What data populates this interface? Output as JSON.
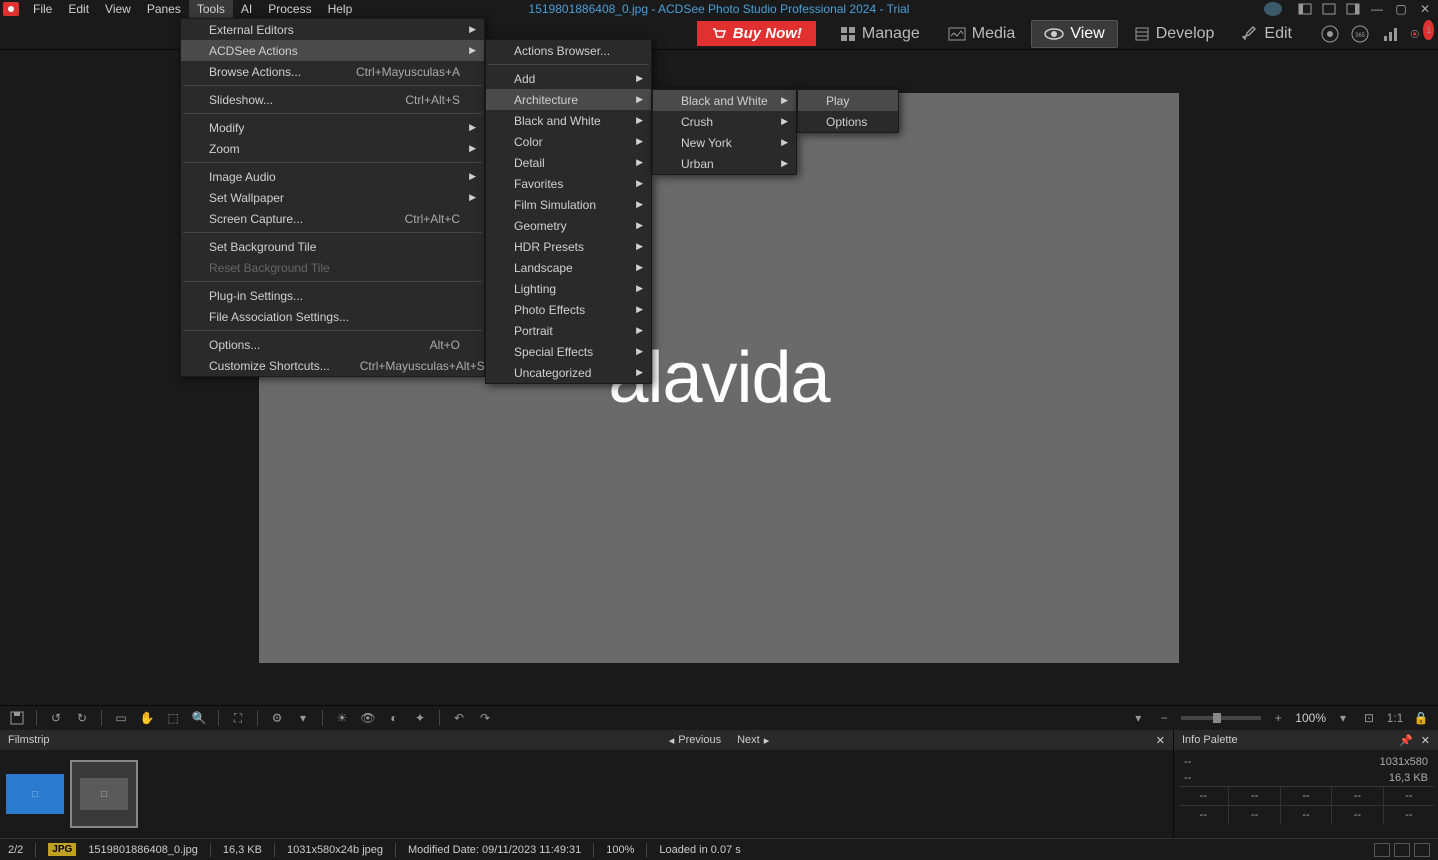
{
  "app": {
    "title": "1519801886408_0.jpg - ACDSee Photo Studio Professional 2024 - Trial"
  },
  "menubar": {
    "items": [
      "File",
      "Edit",
      "View",
      "Panes",
      "Tools",
      "AI",
      "Process",
      "Help"
    ],
    "active_index": 4
  },
  "modebar": {
    "buy": "Buy Now!",
    "modes": [
      "Manage",
      "Media",
      "View",
      "Develop",
      "Edit"
    ],
    "active_index": 2,
    "notification_count": "1"
  },
  "tools_menu": {
    "items": [
      {
        "label": "External Editors",
        "arrow": true
      },
      {
        "label": "ACDSee Actions",
        "arrow": true,
        "highlighted": true
      },
      {
        "label": "Browse Actions...",
        "shortcut": "Ctrl+Mayusculas+A"
      },
      {
        "sep": true
      },
      {
        "label": "Slideshow...",
        "shortcut": "Ctrl+Alt+S"
      },
      {
        "sep": true
      },
      {
        "label": "Modify",
        "arrow": true
      },
      {
        "label": "Zoom",
        "arrow": true
      },
      {
        "sep": true
      },
      {
        "label": "Image Audio",
        "arrow": true
      },
      {
        "label": "Set Wallpaper",
        "arrow": true
      },
      {
        "label": "Screen Capture...",
        "shortcut": "Ctrl+Alt+C"
      },
      {
        "sep": true
      },
      {
        "label": "Set Background Tile"
      },
      {
        "label": "Reset Background Tile",
        "disabled": true
      },
      {
        "sep": true
      },
      {
        "label": "Plug-in Settings..."
      },
      {
        "label": "File Association Settings..."
      },
      {
        "sep": true
      },
      {
        "label": "Options...",
        "shortcut": "Alt+O"
      },
      {
        "label": "Customize Shortcuts...",
        "shortcut": "Ctrl+Mayusculas+Alt+S"
      }
    ]
  },
  "actions_menu": {
    "items": [
      {
        "label": "Actions Browser..."
      },
      {
        "sep": true
      },
      {
        "label": "Add",
        "arrow": true
      },
      {
        "label": "Architecture",
        "arrow": true,
        "highlighted": true
      },
      {
        "label": "Black and White",
        "arrow": true
      },
      {
        "label": "Color",
        "arrow": true
      },
      {
        "label": "Detail",
        "arrow": true
      },
      {
        "label": "Favorites",
        "arrow": true
      },
      {
        "label": "Film Simulation",
        "arrow": true
      },
      {
        "label": "Geometry",
        "arrow": true
      },
      {
        "label": "HDR Presets",
        "arrow": true
      },
      {
        "label": "Landscape",
        "arrow": true
      },
      {
        "label": "Lighting",
        "arrow": true
      },
      {
        "label": "Photo Effects",
        "arrow": true
      },
      {
        "label": "Portrait",
        "arrow": true
      },
      {
        "label": "Special Effects",
        "arrow": true
      },
      {
        "label": "Uncategorized",
        "arrow": true
      }
    ]
  },
  "architecture_menu": {
    "items": [
      {
        "label": "Black and White",
        "arrow": true,
        "highlighted": true
      },
      {
        "label": "Crush",
        "arrow": true
      },
      {
        "label": "New York",
        "arrow": true
      },
      {
        "label": "Urban",
        "arrow": true
      }
    ]
  },
  "bw_menu": {
    "items": [
      {
        "label": "Play",
        "highlighted": true
      },
      {
        "label": "Options"
      }
    ]
  },
  "viewer": {
    "watermark": "alavida"
  },
  "toolbar": {
    "zoom_pct": "100%"
  },
  "filmstrip": {
    "title": "Filmstrip",
    "prev": "Previous",
    "next": "Next"
  },
  "info_palette": {
    "title": "Info Palette",
    "dim": "1031x580",
    "size": "16,3 KB",
    "dash": "--"
  },
  "statusbar": {
    "count": "2/2",
    "format": "JPG",
    "filename": "1519801886408_0.jpg",
    "filesize": "16,3 KB",
    "dims": "1031x580x24b jpeg",
    "modified": "Modified Date: 09/11/2023 11:49:31",
    "zoom": "100%",
    "loaded": "Loaded in 0.07 s"
  }
}
